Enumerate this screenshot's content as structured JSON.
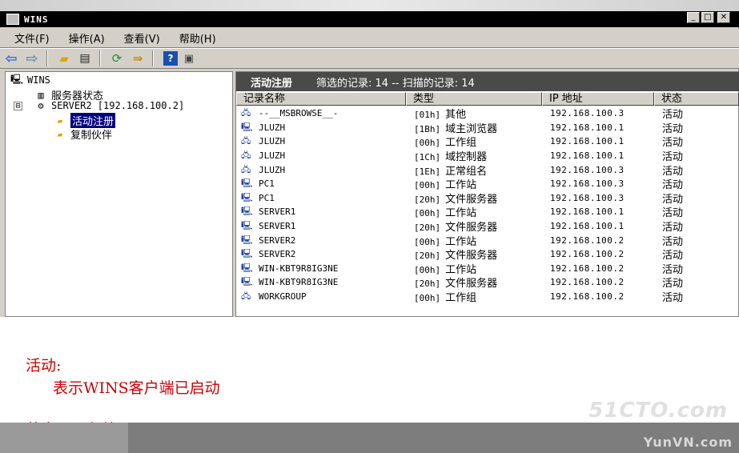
{
  "window": {
    "title": "WINS"
  },
  "menu": [
    {
      "label": "文件(F)"
    },
    {
      "label": "操作(A)"
    },
    {
      "label": "查看(V)"
    },
    {
      "label": "帮助(H)"
    }
  ],
  "tree": {
    "root": "WINS",
    "server_status": "服务器状态",
    "server": "SERVER2 [192.168.100.2]",
    "active_reg": "活动注册",
    "replication": "复制伙伴",
    "expander": "⊟"
  },
  "panel": {
    "title": "活动注册",
    "summary": "筛选的记录: 14 -- 扫描的记录: 14"
  },
  "columns": [
    "记录名称",
    "类型",
    "IP 地址",
    "状态"
  ],
  "rows": [
    {
      "name": "--__MSBROWSE__-",
      "code": "[01h]",
      "type": "其他",
      "ip": "192.168.100.3",
      "state": "活动",
      "icon": "group-icon"
    },
    {
      "name": "JLUZH",
      "code": "[1Bh]",
      "type": "域主浏览器",
      "ip": "192.168.100.1",
      "state": "活动",
      "icon": "computer-icon"
    },
    {
      "name": "JLUZH",
      "code": "[00h]",
      "type": "工作组",
      "ip": "192.168.100.1",
      "state": "活动",
      "icon": "group-icon"
    },
    {
      "name": "JLUZH",
      "code": "[1Ch]",
      "type": "域控制器",
      "ip": "192.168.100.1",
      "state": "活动",
      "icon": "group-icon"
    },
    {
      "name": "JLUZH",
      "code": "[1Eh]",
      "type": "正常组名",
      "ip": "192.168.100.3",
      "state": "活动",
      "icon": "group-icon"
    },
    {
      "name": "PC1",
      "code": "[00h]",
      "type": "工作站",
      "ip": "192.168.100.3",
      "state": "活动",
      "icon": "computer-icon"
    },
    {
      "name": "PC1",
      "code": "[20h]",
      "type": "文件服务器",
      "ip": "192.168.100.3",
      "state": "活动",
      "icon": "computer-icon"
    },
    {
      "name": "SERVER1",
      "code": "[00h]",
      "type": "工作站",
      "ip": "192.168.100.1",
      "state": "活动",
      "icon": "computer-icon"
    },
    {
      "name": "SERVER1",
      "code": "[20h]",
      "type": "文件服务器",
      "ip": "192.168.100.1",
      "state": "活动",
      "icon": "computer-icon"
    },
    {
      "name": "SERVER2",
      "code": "[00h]",
      "type": "工作站",
      "ip": "192.168.100.2",
      "state": "活动",
      "icon": "computer-icon"
    },
    {
      "name": "SERVER2",
      "code": "[20h]",
      "type": "文件服务器",
      "ip": "192.168.100.2",
      "state": "活动",
      "icon": "computer-icon"
    },
    {
      "name": "WIN-KBT9R8IG3NE",
      "code": "[00h]",
      "type": "工作站",
      "ip": "192.168.100.2",
      "state": "活动",
      "icon": "computer-icon"
    },
    {
      "name": "WIN-KBT9R8IG3NE",
      "code": "[20h]",
      "type": "文件服务器",
      "ip": "192.168.100.2",
      "state": "活动",
      "icon": "computer-icon"
    },
    {
      "name": "WORKGROUP",
      "code": "[00h]",
      "type": "工作组",
      "ip": "192.168.100.2",
      "state": "活动",
      "icon": "group-icon"
    }
  ],
  "notes": {
    "heading": "活动:",
    "line1": "表示WINS客户端已启动",
    "line2": "若出现已释放"
  },
  "watermarks": {
    "wm1": "51CTO.com",
    "wm2": "YunVN.com"
  },
  "colors": {
    "note_text": "#cc0000",
    "selection": "#000080",
    "panel_header": "#4a4a4a"
  }
}
